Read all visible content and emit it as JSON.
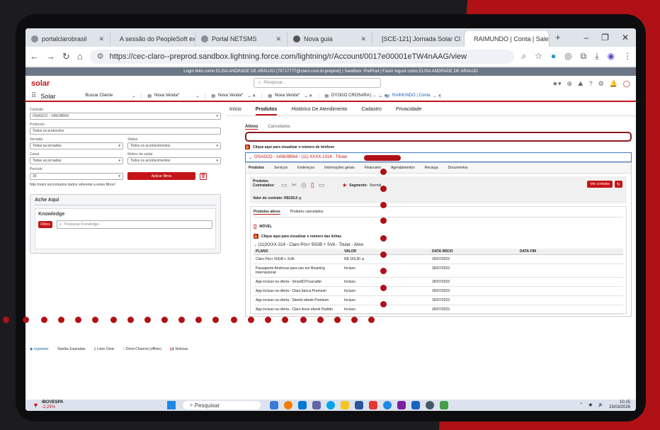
{
  "browser": {
    "tabs": [
      {
        "label": "portalclarobrasil",
        "color": "#6b7280"
      },
      {
        "label": "A sessão do PeopleSoft ex",
        "color": "#6b7280"
      },
      {
        "label": "Portal NETSMS",
        "color": "#6b7280"
      },
      {
        "label": "Nova guia",
        "color": "#6b7280"
      },
      {
        "label": "[SCE-121] Jornada Solar Cl",
        "color": "#1f6feb"
      },
      {
        "label": "RAIMUNDO | Conta | Sales",
        "color": "#1798c1"
      }
    ],
    "url": "https://cec-claro--preprod.sandbox.lightning.force.com/lightning/r/Account/0017e00001eTW4nAAG/view"
  },
  "salesforce": {
    "login_banner": "Login feito como ELISA ANDRADE DE ARAUJO (79717777@claro.com.br.preprod) | Sandbox: PreProd | Fazer logout como ELISA ANDRADE DE ARAUJO",
    "logo": "solar",
    "search_placeholder": "Pesquisar...",
    "app_name": "Solar",
    "nav_tabs": [
      "Buscar Cliente",
      "Nova Venda*",
      "Nova Venda*",
      "Nova Venda*",
      "Nova Venda*",
      "DYOGO CROSARA | ...",
      "RAIMUNDO | Conta"
    ]
  },
  "left": {
    "contrato_label": "Contrato",
    "contrato_value": "OSASCO - 145638564",
    "protocolo_label": "Protocolo",
    "protocolo_value": "Todos os protocolos",
    "jornada_label": "Jornada",
    "jornada_value": "Todas as jornadas",
    "status_label": "Status",
    "status_value": "Todos os acontecimentos",
    "canal_label": "Canal",
    "canal_value": "Todas as jornadas",
    "motivo_label": "Motivo da saída",
    "motivo_value": "Todos os acontecimentos",
    "periodo_label": "Período",
    "periodo_value": "30",
    "apply_label": "Aplicar filtros",
    "empty_msg": "Não foram encontrados dados referente a estes filtros!",
    "ache_aqui": "Ache Aqui",
    "knowledge": "Knowledge",
    "filtros": "Filtros",
    "knowledge_placeholder": "Pesquisar Knowledge..."
  },
  "right": {
    "tabs": [
      "Início",
      "Produtos",
      "Histórico De Atendimento",
      "Cadastro",
      "Privacidade"
    ],
    "sub_tabs": [
      "Ativos",
      "Cancelados"
    ],
    "phone_link": "Clique aqui para visualizar o número de telefone",
    "account_line": "OSASCO - 145638564 - (11) XXXX-1314 - Titular",
    "inner_tabs": [
      "Produtos",
      "Serviços",
      "Endereços",
      "Informações gerais",
      "Financeiro",
      "Agendamentos",
      "Recarga",
      "Documentos"
    ],
    "produtos_contratados": "Produtos Contratados:",
    "segmento_label": "Segmento:",
    "segmento_value": "Normal",
    "ver_contrato": "Ver contrato",
    "valor_contrato": "Valor do contrato: R$159,9",
    "produtos_ativos": "Produtos ativos",
    "produtos_cancelados": "Produtos cancelados",
    "movel": "MÓVEL",
    "linhas_link": "Clique aqui para visualizar o número das linhas",
    "plan_line": "(11)XXXX-314 - Claro Pós+ 50GB + SVA - Titular - Ativo",
    "table_headers": [
      "PLANO",
      "VALOR",
      "DATA INÍCIO",
      "DATA FIM"
    ],
    "table_rows": [
      [
        "Claro Pós+ 50GB + SVA",
        "R$ 159,90",
        "26/07/2023",
        ""
      ],
      [
        "Passaporte Américas para uso em Roaming Internacional",
        "Incluso",
        "26/07/2023",
        ""
      ],
      [
        "App incluso na oferta - SmartID/Truecaller",
        "Incluso",
        "26/07/2023",
        ""
      ],
      [
        "App incluso na oferta - Claro banca Premium",
        "Incluso",
        "26/07/2023",
        ""
      ],
      [
        "App incluso na oferta - Skeelo ebook Premium",
        "Incluso",
        "26/07/2023",
        ""
      ],
      [
        "App incluso na oferta - Claro livros ebook Padrão",
        "Incluso",
        "26/07/2023",
        ""
      ]
    ]
  },
  "util_bar": [
    "Tarefas Expiradas",
    "Links Úteis",
    "Omni-Channel (offline)",
    "Notícias"
  ],
  "taskbar": {
    "stock_name": "IBOVESPA",
    "stock_change": "-2,25%",
    "search": "Pesquisar",
    "time": "10:15",
    "date": "23/03/2026"
  }
}
